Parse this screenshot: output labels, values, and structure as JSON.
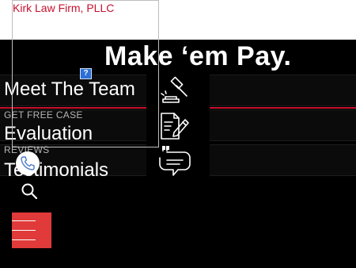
{
  "header": {
    "firm_name": "Kirk Law Firm, PLLC"
  },
  "hero": {
    "headline": "Make ‘em Pay."
  },
  "menu": [
    {
      "label": "Meet The Team",
      "icon": "gavel-icon"
    },
    {
      "kicker": "GET FREE CASE",
      "label": "Evaluation",
      "icon": "document-edit-icon"
    },
    {
      "kicker": "REVIEWS",
      "label": "Testimonials",
      "icon": "quote-bubble-icon"
    }
  ],
  "icons": {
    "help": "?",
    "phone": "phone-icon",
    "search": "search-icon",
    "menu": "hamburger-menu-icon"
  },
  "colors": {
    "accent_red": "#c8102e",
    "menu_button": "#e03a3a",
    "background": "#000000",
    "help_blue": "#2c6fd6"
  }
}
